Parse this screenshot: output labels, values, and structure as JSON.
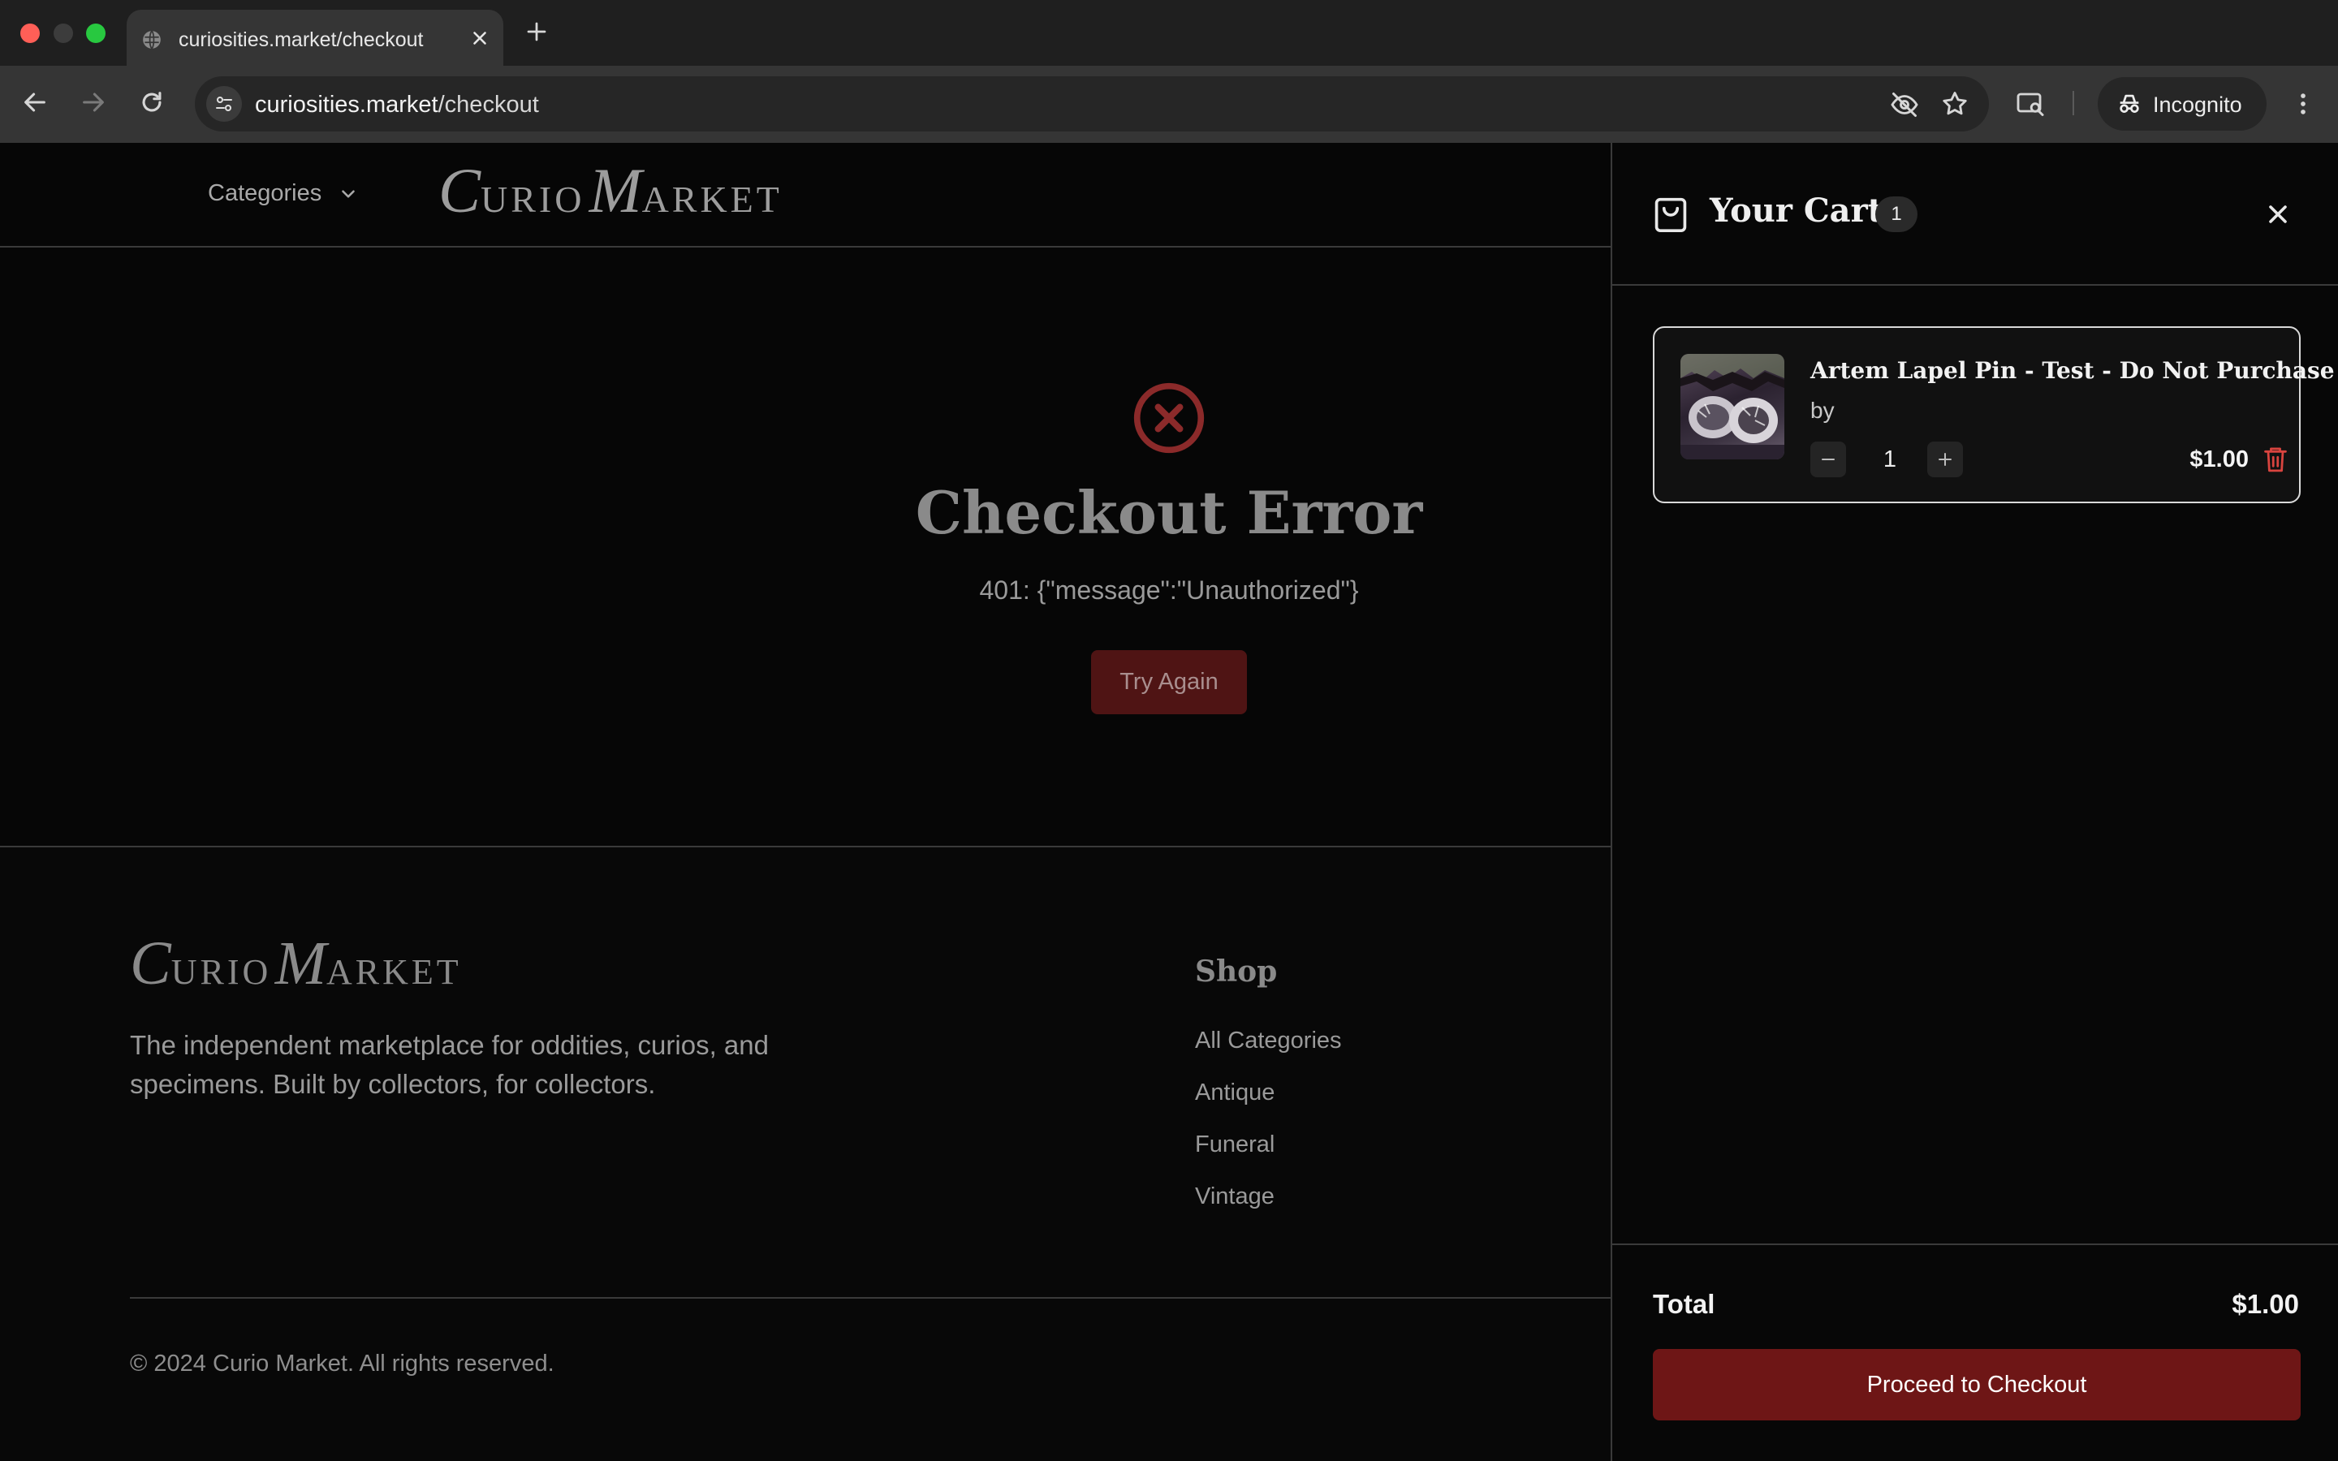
{
  "browser": {
    "tab_title": "curiosities.market/checkout",
    "url_host": "curiosities.market",
    "url_path": "/checkout",
    "incognito_label": "Incognito"
  },
  "header": {
    "categories_label": "Categories",
    "logo": {
      "c1": "C",
      "w1": "URIO",
      "c2": "M",
      "w2": "ARKET"
    }
  },
  "error": {
    "title": "Checkout Error",
    "message": "401: {\"message\":\"Unauthorized\"}",
    "retry_label": "Try Again"
  },
  "footer": {
    "logo": {
      "c1": "C",
      "w1": "URIO",
      "c2": "M",
      "w2": "ARKET"
    },
    "tagline": "The independent marketplace for oddities, curios, and specimens. Built by collectors, for collectors.",
    "shop_heading": "Shop",
    "shop_links": [
      "All Categories",
      "Antique",
      "Funeral",
      "Vintage"
    ],
    "copyright": "© 2024 Curio Market. All rights reserved."
  },
  "cart": {
    "title": "Your Cart",
    "count": "1",
    "items": [
      {
        "name": "Artem Lapel Pin - Test - Do Not Purchase",
        "by": "by",
        "quantity": "1",
        "price": "$1.00"
      }
    ],
    "total_label": "Total",
    "total_value": "$1.00",
    "checkout_label": "Proceed to Checkout"
  },
  "colors": {
    "accent_red": "#6e1616",
    "error_icon": "#8b2a2a",
    "delete_icon": "#d9443f"
  }
}
